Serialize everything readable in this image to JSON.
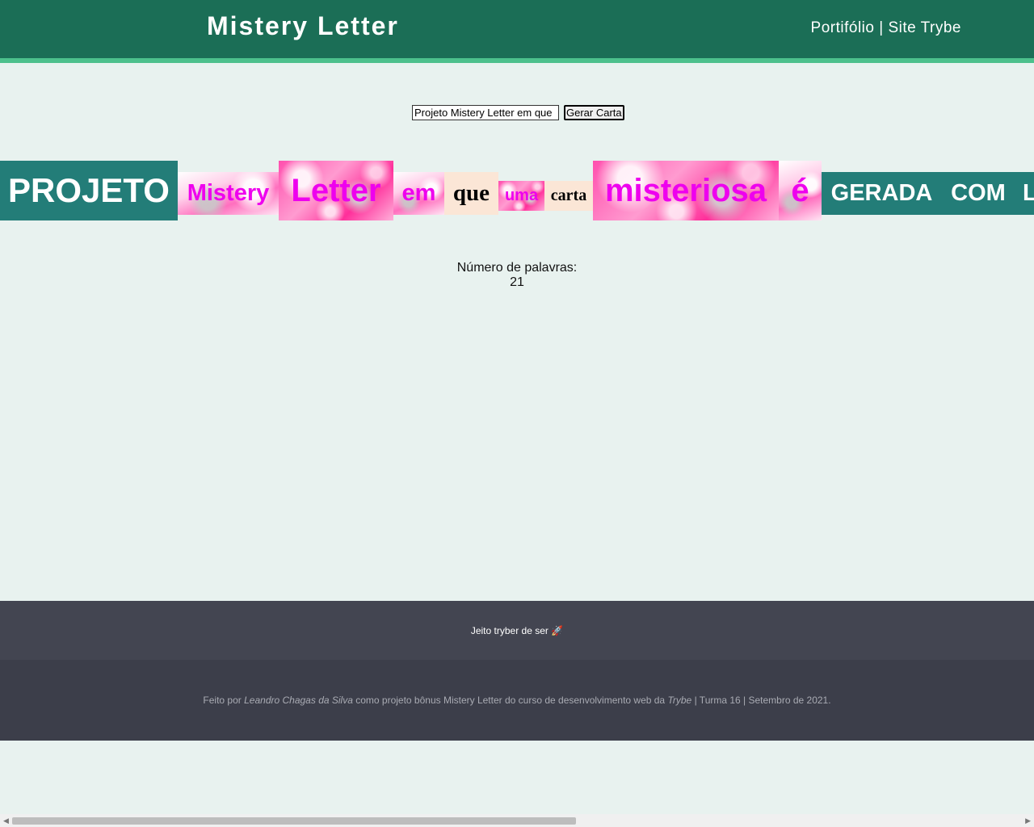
{
  "header": {
    "title": "Mistery Letter",
    "nav_portfolio": "Portifólio",
    "nav_separator": "|",
    "nav_site": "Site Trybe"
  },
  "form": {
    "input_value": "Projeto Mistery Letter em que",
    "button_label": "Gerar Carta"
  },
  "letter_words": [
    "PROJETO",
    "Mistery",
    "Letter",
    "em",
    "que",
    "uma",
    "carta",
    "misteriosa",
    "é",
    "GERADA",
    "COM",
    "L"
  ],
  "counter": {
    "label": "Número de palavras:",
    "value": "21"
  },
  "footer": {
    "slogan": "Jeito tryber de ser 🚀",
    "credit_prefix": "Feito por ",
    "author": "Leandro Chagas da Silva",
    "credit_middle": " como projeto bônus Mistery Letter do curso de desenvolvimento web da ",
    "school": "Trybe",
    "credit_suffix": " | Turma 16 | Setembro de 2021."
  },
  "colors": {
    "header_bg": "#1b6e56",
    "header_accent": "#4cc08c",
    "page_bg": "#e8f2ef",
    "teal_word": "#237d78",
    "pink_text": "#ee00ee",
    "peach_word": "#fbe6d6",
    "footer_top": "#434551",
    "footer_bottom": "#3c3e4a"
  }
}
